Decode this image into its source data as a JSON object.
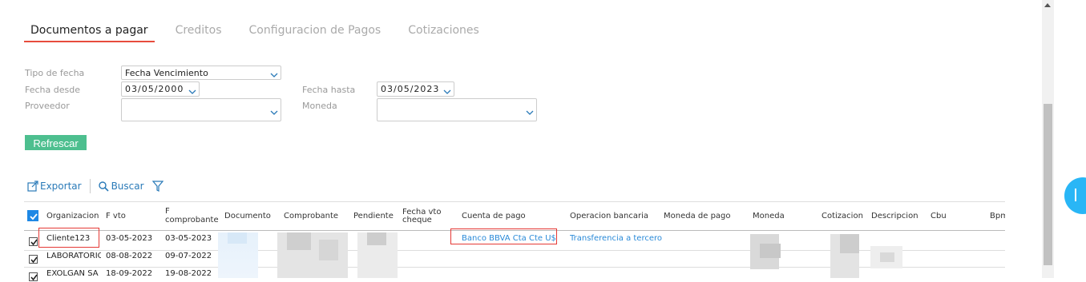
{
  "tabs": [
    {
      "label": "Documentos a pagar"
    },
    {
      "label": "Creditos"
    },
    {
      "label": "Configuracion de Pagos"
    },
    {
      "label": "Cotizaciones"
    }
  ],
  "filters": {
    "tipo_fecha_label": "Tipo de fecha",
    "tipo_fecha_value": "Fecha Vencimiento",
    "fecha_desde_label": "Fecha desde",
    "fecha_desde_value": "03/05/2000",
    "fecha_hasta_label": "Fecha hasta",
    "fecha_hasta_value": "03/05/2023",
    "proveedor_label": "Proveedor",
    "proveedor_value": "",
    "moneda_label": "Moneda",
    "moneda_value": ""
  },
  "refresh_label": "Refrescar",
  "toolbar": {
    "export_label": "Exportar",
    "search_label": "Buscar"
  },
  "columns": {
    "organizacion": "Organizacion",
    "fvto": "F vto",
    "fcomp1": "F",
    "fcomp2": "comprobante",
    "documento": "Documento",
    "comprobante": "Comprobante",
    "pendiente": "Pendiente",
    "fechavto1": "Fecha vto",
    "fechavto2": "cheque",
    "cuenta": "Cuenta de pago",
    "operacion": "Operacion bancaria",
    "monedapago": "Moneda de pago",
    "moneda": "Moneda",
    "cotizacion": "Cotizacion",
    "descripcion": "Descripcion",
    "cbu": "Cbu",
    "bpm": "Bpm"
  },
  "rows": [
    {
      "org": "Cliente123",
      "fvto": "03-05-2023",
      "fcomp": "03-05-2023",
      "cuenta": "Banco BBVA Cta Cte U$",
      "operacion": "Transferencia a tercero"
    },
    {
      "org": "LABORATORIO",
      "fvto": "08-08-2022",
      "fcomp": "09-07-2022",
      "cuenta": "",
      "operacion": ""
    },
    {
      "org": "EXOLGAN SA",
      "fvto": "18-09-2022",
      "fcomp": "19-08-2022",
      "cuenta": "",
      "operacion": ""
    }
  ],
  "colors": {
    "accent": "#e74c3c",
    "button": "#4dbf8f",
    "link": "#2a8ad8",
    "checkbox": "#1e88e5"
  }
}
